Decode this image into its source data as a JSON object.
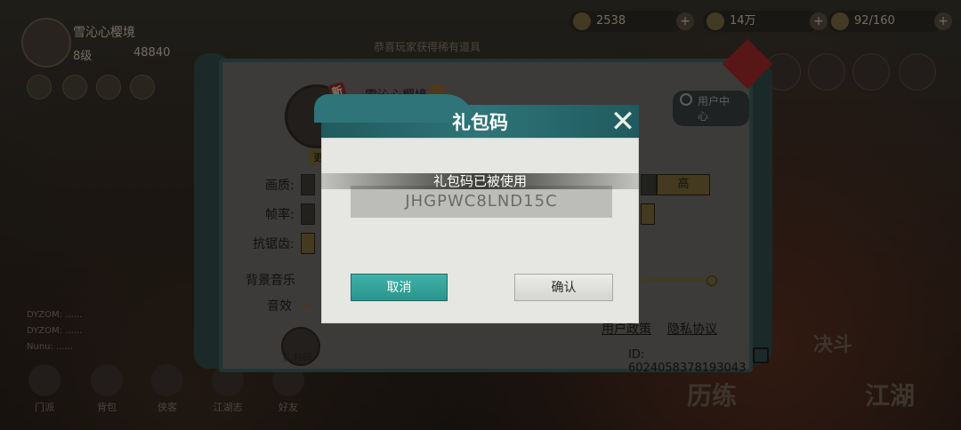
{
  "hud": {
    "player_name": "雪沁心樱境",
    "level": "8级",
    "power": "48840",
    "resources": [
      {
        "icon": "token-icon",
        "value": "2538"
      },
      {
        "icon": "coin-icon",
        "value": "14万"
      },
      {
        "icon": "stamina-icon",
        "value": "92/160"
      }
    ],
    "notice": "恭喜玩家获得稀有道具"
  },
  "settings": {
    "new_badge": "新",
    "name": "雪沁心樱境",
    "change_label": "更换",
    "user_center_label": "用户中心",
    "labels": {
      "quality": "画质:",
      "framerate": "帧率:",
      "antialias": "抗锯齿:",
      "bgm": "背景音乐",
      "sfx": "音效"
    },
    "quality_high": "高",
    "privacy_policy": "用户政策",
    "privacy_protocol": "隐私协议",
    "id_text": "ID: 6024058378193043",
    "gift_code_label": "礼包码"
  },
  "bottom_nav": [
    "门派",
    "背包",
    "侠客",
    "江湖志",
    "好友"
  ],
  "big_buttons": {
    "left": "历练",
    "right": "江湖",
    "battle": "决斗"
  },
  "modal": {
    "title": "礼包码",
    "close_glyph": "✕",
    "code_value": "JHGPWC8LND15C",
    "toast": "礼包码已被使用",
    "cancel_label": "取消",
    "ok_label": "确认"
  },
  "colors": {
    "header_teal": "#2e7478",
    "cancel_teal": "#3fb2a8",
    "modal_bg": "#e6e6e3"
  }
}
